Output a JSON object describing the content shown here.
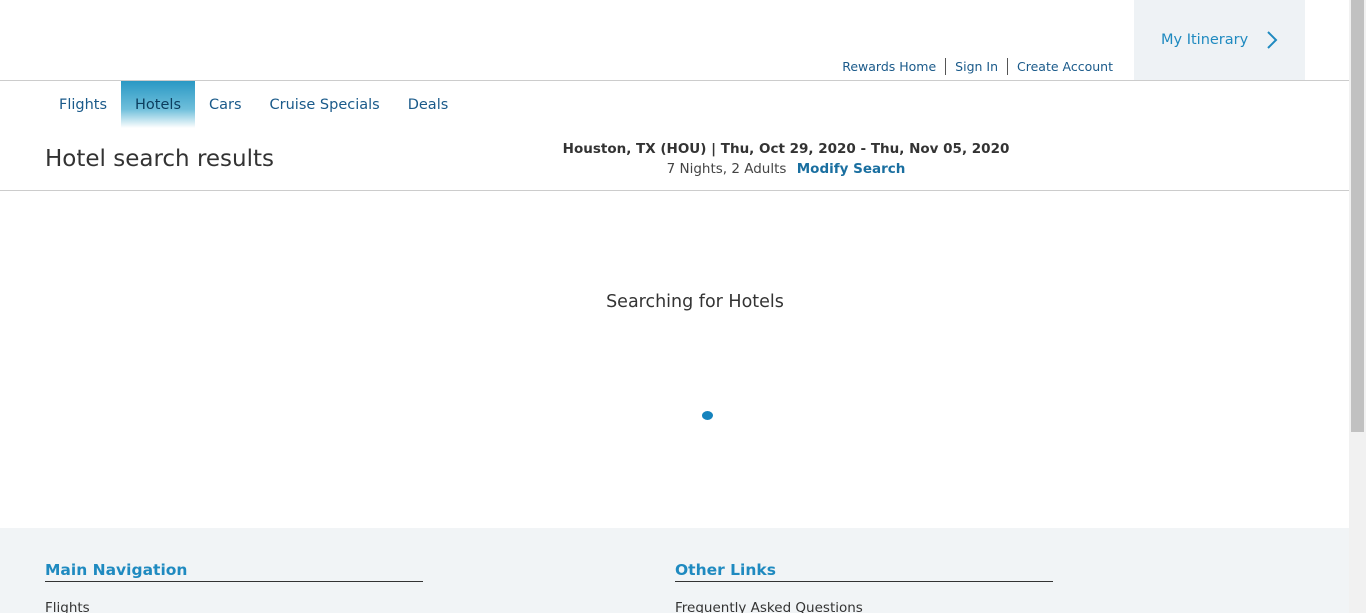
{
  "header": {
    "util_links": [
      "Rewards Home",
      "Sign In",
      "Create Account"
    ],
    "itinerary_label": "My Itinerary"
  },
  "nav": {
    "tabs": [
      "Flights",
      "Hotels",
      "Cars",
      "Cruise Specials",
      "Deals"
    ],
    "active_tab": "Hotels"
  },
  "main": {
    "title": "Hotel search results",
    "summary_line1": "Houston, TX (HOU) | Thu, Oct 29, 2020 - Thu, Nov 05, 2020",
    "summary_line2": "7 Nights, 2 Adults",
    "modify_label": "Modify Search",
    "loading_text": "Searching for Hotels"
  },
  "footer": {
    "main_nav_title": "Main Navigation",
    "main_nav_first": "Flights",
    "other_links_title": "Other Links",
    "other_links_first": "Frequently Asked Questions"
  },
  "colors": {
    "accent": "#1f8ac0",
    "link": "#1a5a8a",
    "active_tab_top": "#2a98c4",
    "spinner": "#1583bd",
    "footer_bg": "#f1f4f6",
    "itinerary_bg": "#eef2f5"
  }
}
